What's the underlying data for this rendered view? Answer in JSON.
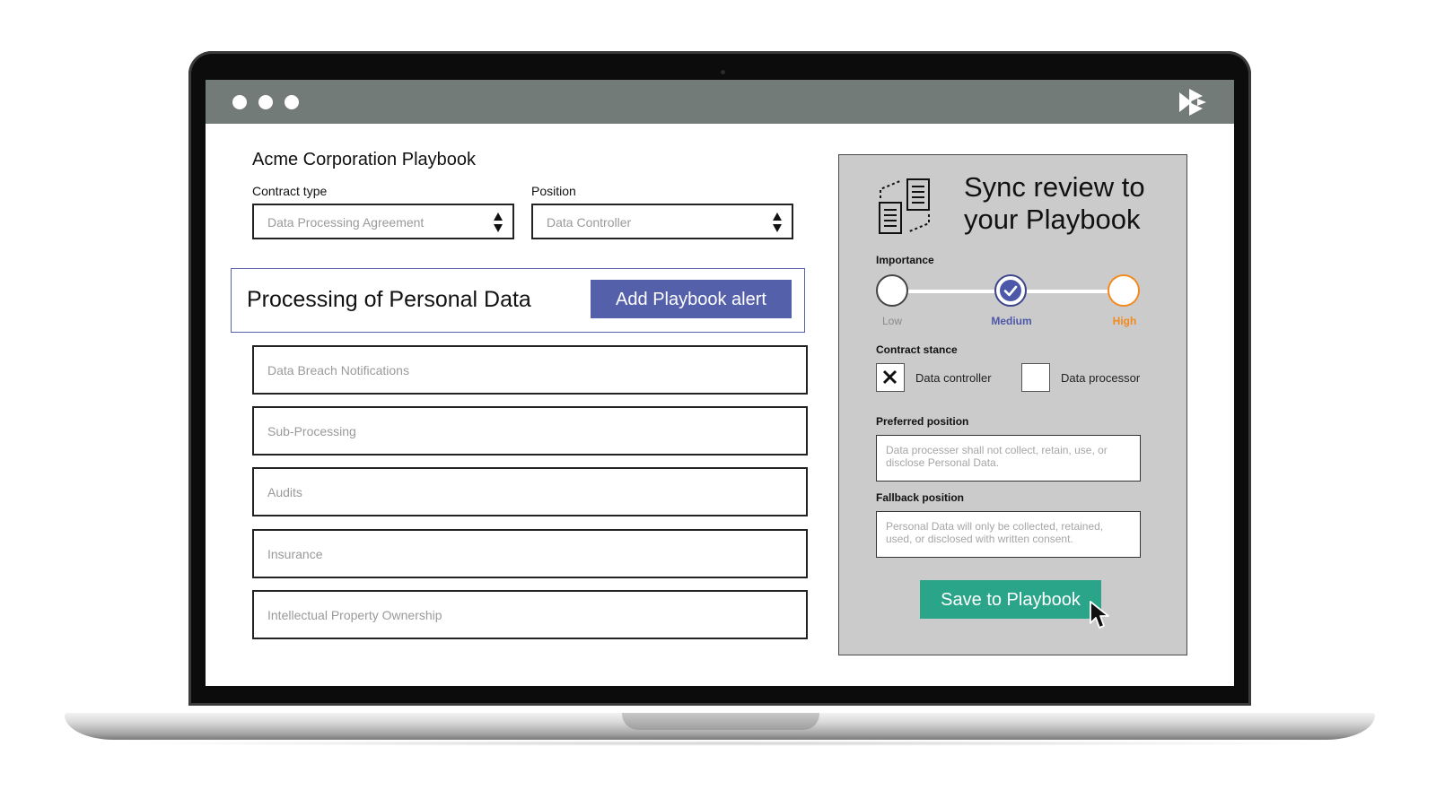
{
  "main": {
    "playbook_title": "Acme Corporation Playbook",
    "contract_type": {
      "label": "Contract type",
      "value": "Data Processing Agreement"
    },
    "position": {
      "label": "Position",
      "value": "Data Controller"
    },
    "section": {
      "title": "Processing of Personal Data",
      "add_alert_label": "Add Playbook alert"
    },
    "clauses": [
      "Data Breach Notifications",
      "Sub-Processing",
      "Audits",
      "Insurance",
      "Intellectual Property Ownership"
    ]
  },
  "panel": {
    "title": "Sync review to your Playbook",
    "importance": {
      "label": "Importance",
      "levels": [
        "Low",
        "Medium",
        "High"
      ],
      "selected": "Medium"
    },
    "contract_stance": {
      "label": "Contract stance",
      "options": [
        {
          "label": "Data controller",
          "checked": true
        },
        {
          "label": "Data processor",
          "checked": false
        }
      ]
    },
    "preferred_position": {
      "label": "Preferred position",
      "placeholder": "Data processer shall not collect, retain, use, or disclose Personal Data."
    },
    "fallback_position": {
      "label": "Fallback position",
      "placeholder": "Personal Data will only be collected, retained, used, or disclosed with written consent."
    },
    "save_label": "Save to Playbook"
  },
  "icons": {
    "brand": "brand-logo-icon",
    "sync": "document-sync-icon",
    "select": "select-arrows-icon",
    "check": "check-icon",
    "x_mark": "x-mark-icon",
    "cursor": "mouse-pointer-icon"
  },
  "colors": {
    "titlebar": "#737b79",
    "accent_blue": "#5560aa",
    "accent_orange": "#f28a1e",
    "accent_green": "#2aa58a",
    "panel_bg": "#cbcbcb"
  }
}
